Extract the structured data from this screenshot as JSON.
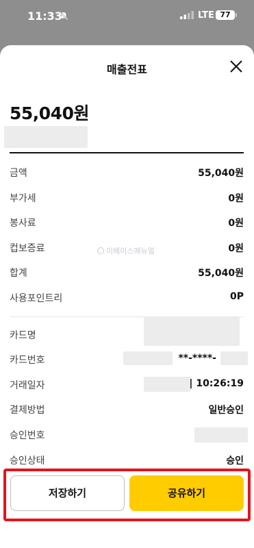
{
  "status": {
    "time": "11:33",
    "network": "LTE",
    "battery": "77"
  },
  "sheet": {
    "title": "매출전표"
  },
  "amount": "55,040원",
  "watermark": "이베이스매뉴얼",
  "rows": [
    {
      "label": "금액",
      "value": "55,040원"
    },
    {
      "label": "부가세",
      "value": "0원"
    },
    {
      "label": "봉사료",
      "value": "0원"
    },
    {
      "label": "컵보증료",
      "value": "0원"
    },
    {
      "label": "합계",
      "value": "55,040원"
    },
    {
      "label": "사용포인트리",
      "value": "0P"
    },
    {
      "label": "카드명",
      "value": ""
    },
    {
      "label": "카드번호",
      "value": "**-****-"
    },
    {
      "label": "거래일자",
      "value": "| 10:26:19"
    },
    {
      "label": "결제방법",
      "value": "일반승인"
    },
    {
      "label": "승인번호",
      "value": ""
    },
    {
      "label": "승인상태",
      "value": "승인"
    }
  ],
  "actions": {
    "save": "저장하기",
    "share": "공유하기"
  },
  "colors": {
    "accent": "#ffcc00",
    "highlight": "#e5131b"
  }
}
